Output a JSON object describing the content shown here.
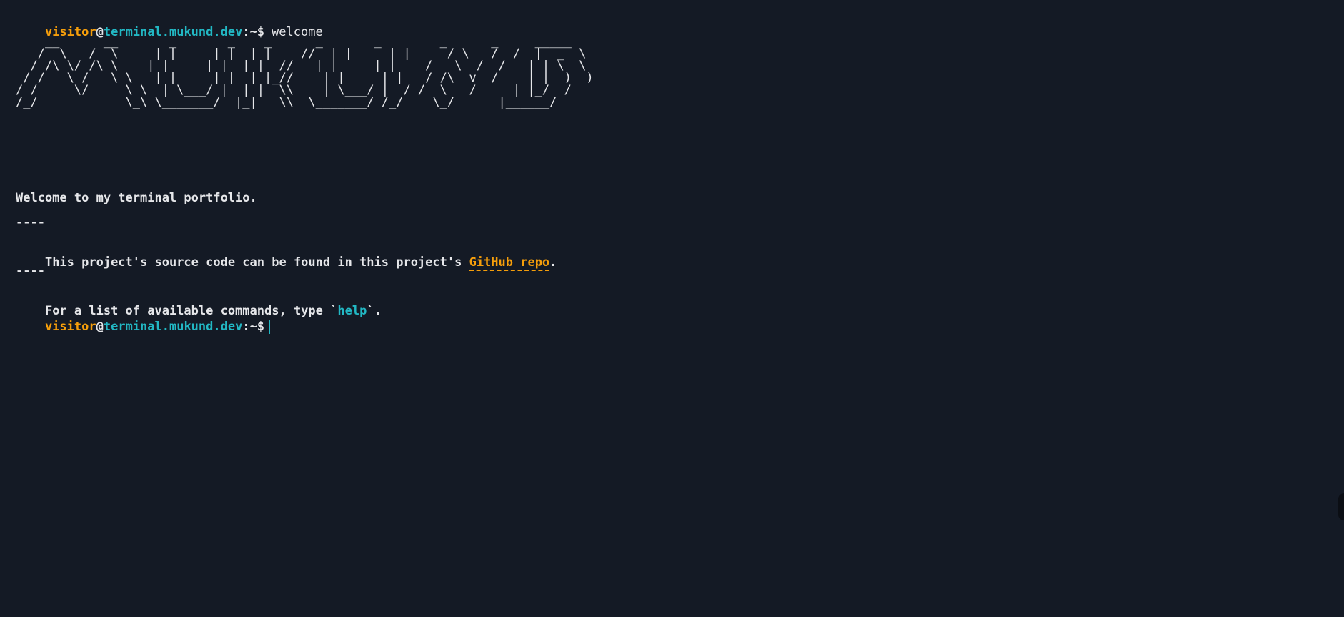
{
  "prompt": {
    "user": "visitor",
    "at": "@",
    "host": "terminal.mukund.dev",
    "path": ":~$"
  },
  "history": [
    {
      "command": "welcome"
    }
  ],
  "banner": {
    "ascii": "    __      __       _       _    _      _       _        _      _     _____\n   /  \\   /  \\     | |     | |  | |    //  | |     | |     / \\   /  /  |  _  \\\n  / /\\ \\/ /\\ \\    | |     | |  | |  //   | |     | |    /   \\  /  /   | | \\  \\\n / /   \\ /   \\ \\   | |     | |  | |_//    | |     | |   / /\\  v  /    | |  )  )\n/ /     \\/     \\ \\  | \\___/ |  | |  \\\\    | \\___/ |  / /  \\   /     | |_/  /\n/_/            \\_\\ \\_______/  |_|   \\\\  \\_______/ /_/    \\_/      |______/"
  },
  "welcome": {
    "intro": "Welcome to my terminal portfolio.",
    "separator": "----",
    "source_prefix": "This project's source code can be found in this project's ",
    "source_link": "GitHub repo",
    "source_suffix": ".",
    "help_prefix": "For a list of available commands, type `",
    "help_keyword": "help",
    "help_suffix": "`."
  },
  "input": {
    "value": ""
  },
  "colors": {
    "background": "#141a25",
    "user": "#f59e0b",
    "host": "#22b8c4",
    "text": "#e6e7ea",
    "link": "#f59e0b",
    "keyword": "#22b8c4"
  }
}
